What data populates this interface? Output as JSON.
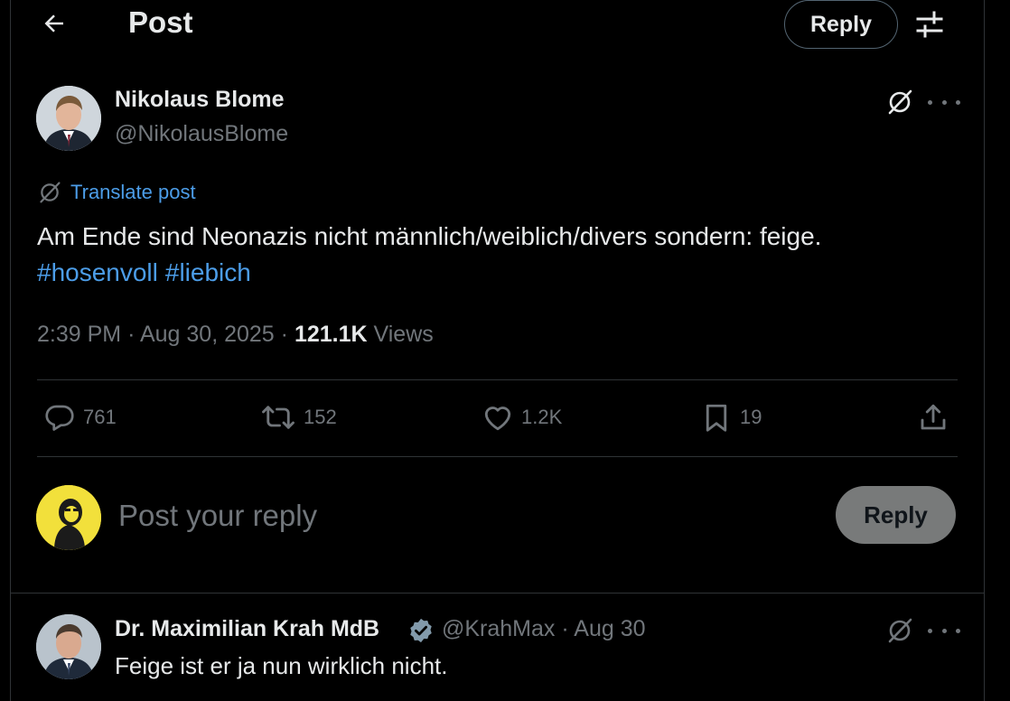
{
  "header": {
    "title": "Post",
    "reply_button": "Reply"
  },
  "post": {
    "author_name": "Nikolaus Blome",
    "author_handle": "@NikolausBlome",
    "translate_label": "Translate post",
    "text": "Am Ende sind Neonazis nicht männlich/weiblich/divers sondern:  feige.",
    "hashtags": [
      "#hosenvoll",
      "#liebich"
    ],
    "time": "2:39 PM",
    "date": "Aug 30, 2025",
    "views_count": "121.1K",
    "views_label": "Views"
  },
  "actions": {
    "replies": "761",
    "reposts": "152",
    "likes": "1.2K",
    "bookmarks": "19"
  },
  "composer": {
    "placeholder": "Post your reply",
    "reply_button": "Reply"
  },
  "reply": {
    "author_name": "Dr. Maximilian Krah MdB",
    "handle": "@KrahMax",
    "date": "Aug 30",
    "text": "Feige ist er ja nun wirklich nicht."
  },
  "icons": {
    "back": "arrow-left-icon",
    "settings": "sliders-icon",
    "grok": "grok-icon",
    "more": "more-horizontal-icon",
    "reply": "speech-bubble-icon",
    "repost": "repost-icon",
    "like": "heart-icon",
    "bookmark": "bookmark-icon",
    "share": "share-icon",
    "verified": "verified-badge-icon"
  },
  "colors": {
    "background": "#000000",
    "text": "#e7e9ea",
    "secondary": "#71767b",
    "link": "#4c9de8",
    "verified": "#829aab"
  }
}
